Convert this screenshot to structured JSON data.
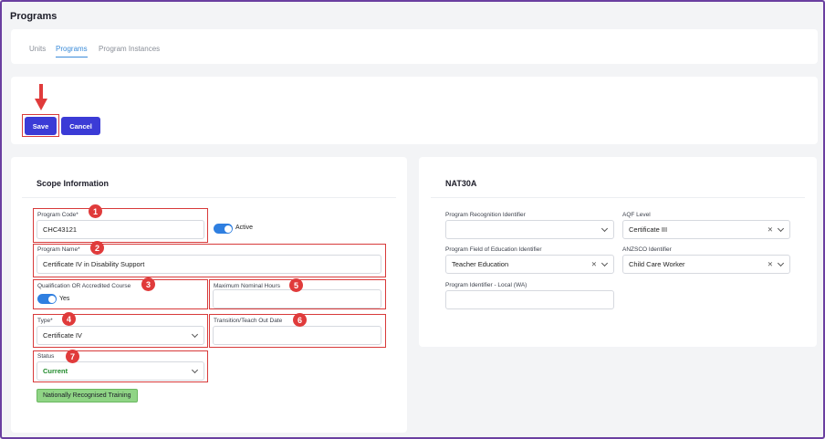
{
  "page": {
    "title": "Programs"
  },
  "tabs": [
    {
      "label": "Units"
    },
    {
      "label": "Programs"
    },
    {
      "label": "Program Instances"
    }
  ],
  "actions": {
    "save_label": "Save",
    "cancel_label": "Cancel"
  },
  "scope": {
    "title": "Scope Information",
    "program_code": {
      "label": "Program Code*",
      "value": "CHC43121"
    },
    "active": {
      "label": "Active",
      "on": true
    },
    "program_name": {
      "label": "Program Name*",
      "value": "Certificate IV in Disability Support"
    },
    "qualification": {
      "label": "Qualification OR Accredited Course",
      "toggle_label": "Yes",
      "on": true
    },
    "max_hours": {
      "label": "Maximum Nominal Hours",
      "value": ""
    },
    "type": {
      "label": "Type*",
      "value": "Certificate IV"
    },
    "transition": {
      "label": "Transition/Teach Out Date",
      "value": ""
    },
    "status": {
      "label": "Status",
      "value": "Current"
    },
    "nrt_badge": "Nationally Recognised Training"
  },
  "nat": {
    "title": "NAT30A",
    "recognition": {
      "label": "Program Recognition Identifier",
      "value": ""
    },
    "aqf": {
      "label": "AQF Level",
      "value": "Certificate III"
    },
    "field_of_education": {
      "label": "Program Field of Education Identifier",
      "value": "Teacher Education"
    },
    "anzsco": {
      "label": "ANZSCO Identifier",
      "value": "Child Care Worker"
    },
    "local_id": {
      "label": "Program Identifier - Local (WA)",
      "value": ""
    }
  },
  "annotations": [
    "1",
    "2",
    "3",
    "4",
    "5",
    "6",
    "7"
  ],
  "colors": {
    "accent": "#3b3bd6",
    "highlight": "#d83a3a",
    "status_green": "#1f8a2a",
    "badge_green": "#8fd485"
  }
}
